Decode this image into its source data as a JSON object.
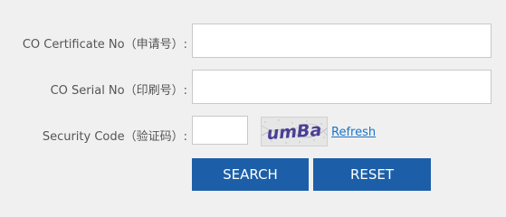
{
  "form": {
    "certificate_no": {
      "label": "CO Certificate No（申请号）:",
      "value": ""
    },
    "serial_no": {
      "label": "CO Serial No（印刷号）:",
      "value": ""
    },
    "security_code": {
      "label": "Security Code（验证码）:",
      "value": "",
      "captcha_text": "umBa",
      "refresh_label": "Refresh"
    }
  },
  "buttons": {
    "search_label": "SEARCH",
    "reset_label": "RESET"
  },
  "colors": {
    "background": "#f0f0f0",
    "button": "#1c5fa8",
    "link": "#1a73c8",
    "label": "#555555"
  }
}
